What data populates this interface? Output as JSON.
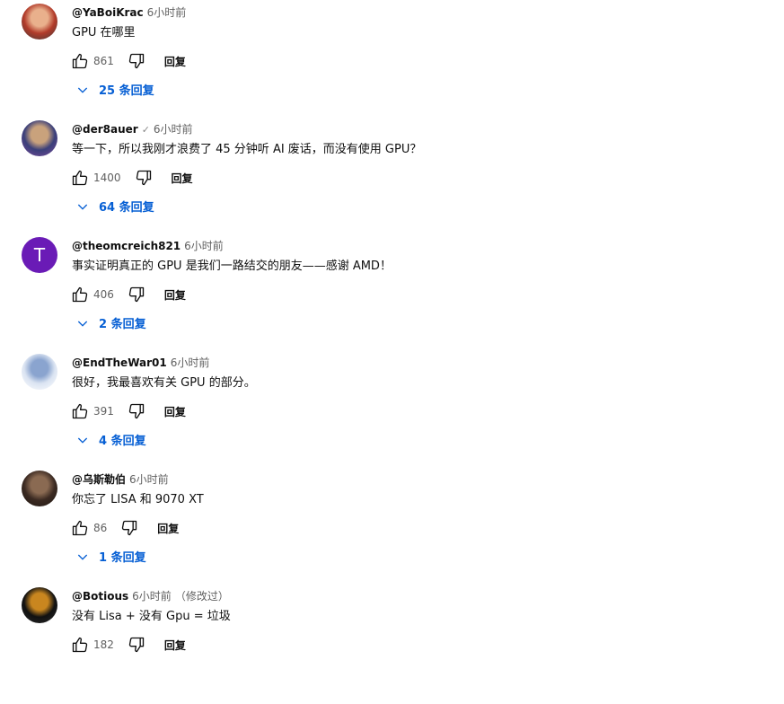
{
  "comments": [
    {
      "author": "@YaBoiKrac",
      "verified": "",
      "time": "6小时前",
      "edited": "",
      "text": "GPU 在哪里",
      "likes": "861",
      "reply_label": "回复",
      "replies": "25 条回复",
      "avatar": {
        "type": "photo",
        "colors": [
          "#b23b2a",
          "#e9b08c",
          "#3a3a3a"
        ]
      }
    },
    {
      "author": "@der8auer",
      "verified": "✓",
      "time": "6小时前",
      "edited": "",
      "text": "等一下，所以我刚才浪费了 45 分钟听 AI 废话，而没有使用 GPU？",
      "likes": "1400",
      "reply_label": "回复",
      "replies": "64 条回复",
      "avatar": {
        "type": "photo",
        "colors": [
          "#3a3f7a",
          "#c9a27c",
          "#7c4a9a"
        ]
      }
    },
    {
      "author": "@theomcreich821",
      "verified": "",
      "time": "6小时前",
      "edited": "",
      "text": "事实证明真正的 GPU 是我们一路结交的朋友——感谢 AMD！",
      "likes": "406",
      "reply_label": "回复",
      "replies": "2 条回复",
      "avatar": {
        "type": "letter",
        "letter": "T",
        "color": "#6a1bb6"
      }
    },
    {
      "author": "@EndTheWar01",
      "verified": "",
      "time": "6小时前",
      "edited": "",
      "text": "很好，我最喜欢有关 GPU 的部分。",
      "likes": "391",
      "reply_label": "回复",
      "replies": "4 条回复",
      "avatar": {
        "type": "photo",
        "colors": [
          "#dbe4f2",
          "#8aa4cf",
          "#ffffff"
        ]
      }
    },
    {
      "author": "@乌斯勒伯",
      "verified": "",
      "time": "6小时前",
      "edited": "",
      "text": "你忘了 LISA 和 9070 XT",
      "likes": "86",
      "reply_label": "回复",
      "replies": "1 条回复",
      "avatar": {
        "type": "photo",
        "colors": [
          "#3b2a22",
          "#8a6a52",
          "#1e1712"
        ]
      }
    },
    {
      "author": "@Botious",
      "verified": "",
      "time": "6小时前",
      "edited": "（修改过）",
      "text": "没有 Lisa + 没有 Gpu = 垃圾",
      "likes": "182",
      "reply_label": "回复",
      "replies": "",
      "avatar": {
        "type": "photo",
        "colors": [
          "#111111",
          "#c9861f",
          "#2a2a2a"
        ]
      }
    }
  ]
}
